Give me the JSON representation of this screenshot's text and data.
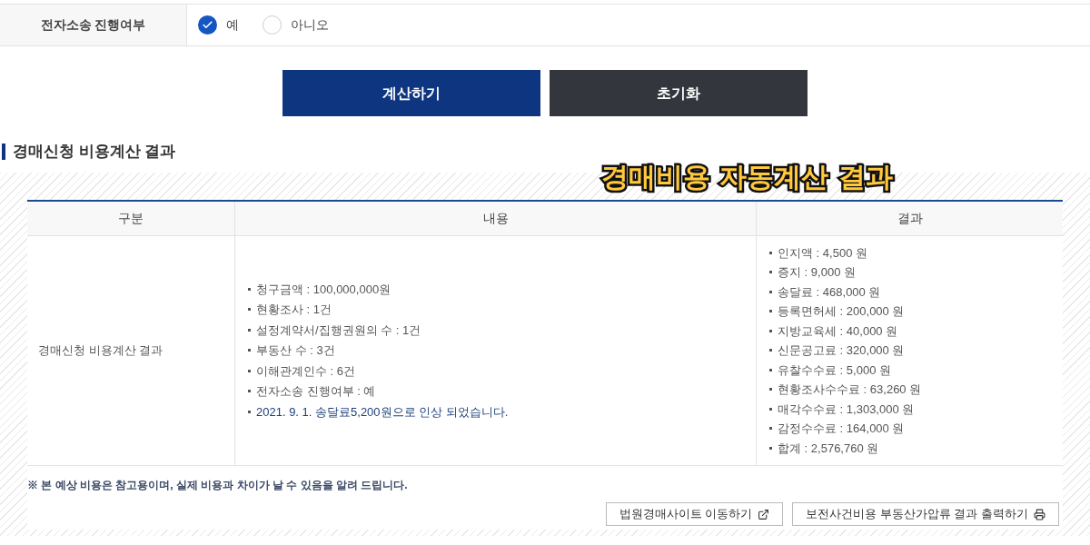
{
  "form_row": {
    "label": "전자소송 진행여부",
    "options": [
      {
        "label": "예",
        "selected": true
      },
      {
        "label": "아니오",
        "selected": false
      }
    ]
  },
  "buttons": [
    {
      "label": "계산하기",
      "kind": "primary"
    },
    {
      "label": "초기화",
      "kind": "secondary"
    }
  ],
  "section_title": "경매신청 비용계산 결과",
  "overlay_caption": "경매비용 자동계산 결과",
  "table": {
    "columns": [
      "구분",
      "내용",
      "결과"
    ],
    "row": {
      "category": "경매신청 비용계산 결과",
      "details": [
        {
          "text": "청구금액 : 100,000,000원",
          "kind": "plain"
        },
        {
          "text": "현황조사 : 1건",
          "kind": "plain"
        },
        {
          "text": "설정계약서/집행권원의 수 : 1건",
          "kind": "plain"
        },
        {
          "text": "부동산 수 : 3건",
          "kind": "plain"
        },
        {
          "text": "이해관계인수 : 6건",
          "kind": "plain"
        },
        {
          "text": "전자소송 진행여부 : 예",
          "kind": "plain"
        },
        {
          "text": "2021. 9. 1. 송달료5,200원으로 인상 되었습니다.",
          "kind": "notice"
        }
      ],
      "results": [
        "인지액 : 4,500 원",
        "증지 : 9,000 원",
        "송달료 : 468,000 원",
        "등록면허세 : 200,000 원",
        "지방교육세 : 40,000 원",
        "신문공고료 : 320,000 원",
        "유찰수수료 : 5,000 원",
        "현황조사수수료 : 63,260 원",
        "매각수수료 : 1,303,000 원",
        "감정수수료 : 164,000 원",
        "합계 : 2,576,760 원"
      ]
    }
  },
  "note": "※ 본 예상 비용은 참고용이며, 실제 비용과 차이가 날 수 있음을 알려 드립니다.",
  "links": [
    {
      "label": "법원경매사이트 이동하기",
      "kind": "external"
    },
    {
      "label": "보전사건비용 부동산가압류 결과 출력하기",
      "kind": "print"
    }
  ]
}
